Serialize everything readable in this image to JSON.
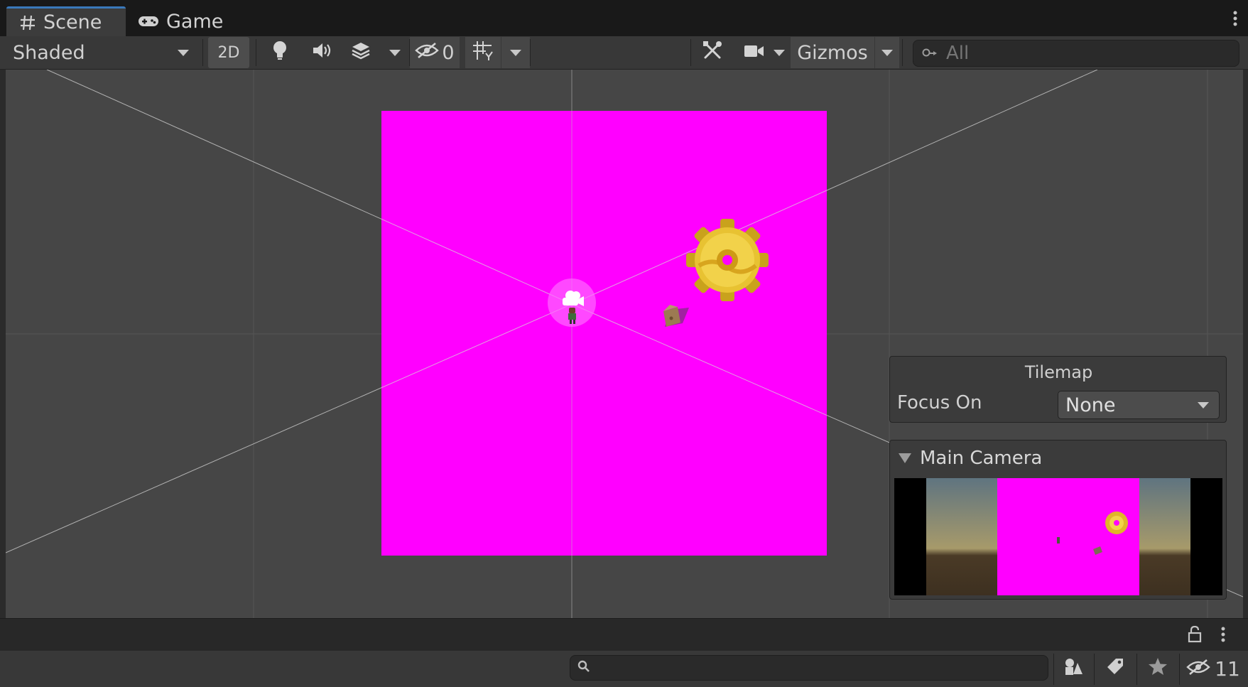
{
  "tabs": [
    {
      "label": "Scene",
      "icon": "hash-icon",
      "active": true
    },
    {
      "label": "Game",
      "icon": "gamepad-icon",
      "active": false
    }
  ],
  "toolbar": {
    "draw_mode": "Shaded",
    "mode_2d": "2D",
    "hidden_count": "0",
    "gizmos": "Gizmos",
    "search_placeholder": "All"
  },
  "overlays": {
    "tilemap": {
      "title": "Tilemap",
      "focus_label": "Focus On",
      "focus_value": "None"
    },
    "camera": {
      "title": "Main Camera"
    }
  },
  "bottom": {
    "hidden_count": "11"
  },
  "colors": {
    "accent": "#3a79bb",
    "tile_background": "#ff00ff",
    "scene_background": "#464646"
  },
  "scene_objects": [
    "gear-sprite",
    "player-character-sprite",
    "crate-sprite",
    "camera-gizmo"
  ]
}
